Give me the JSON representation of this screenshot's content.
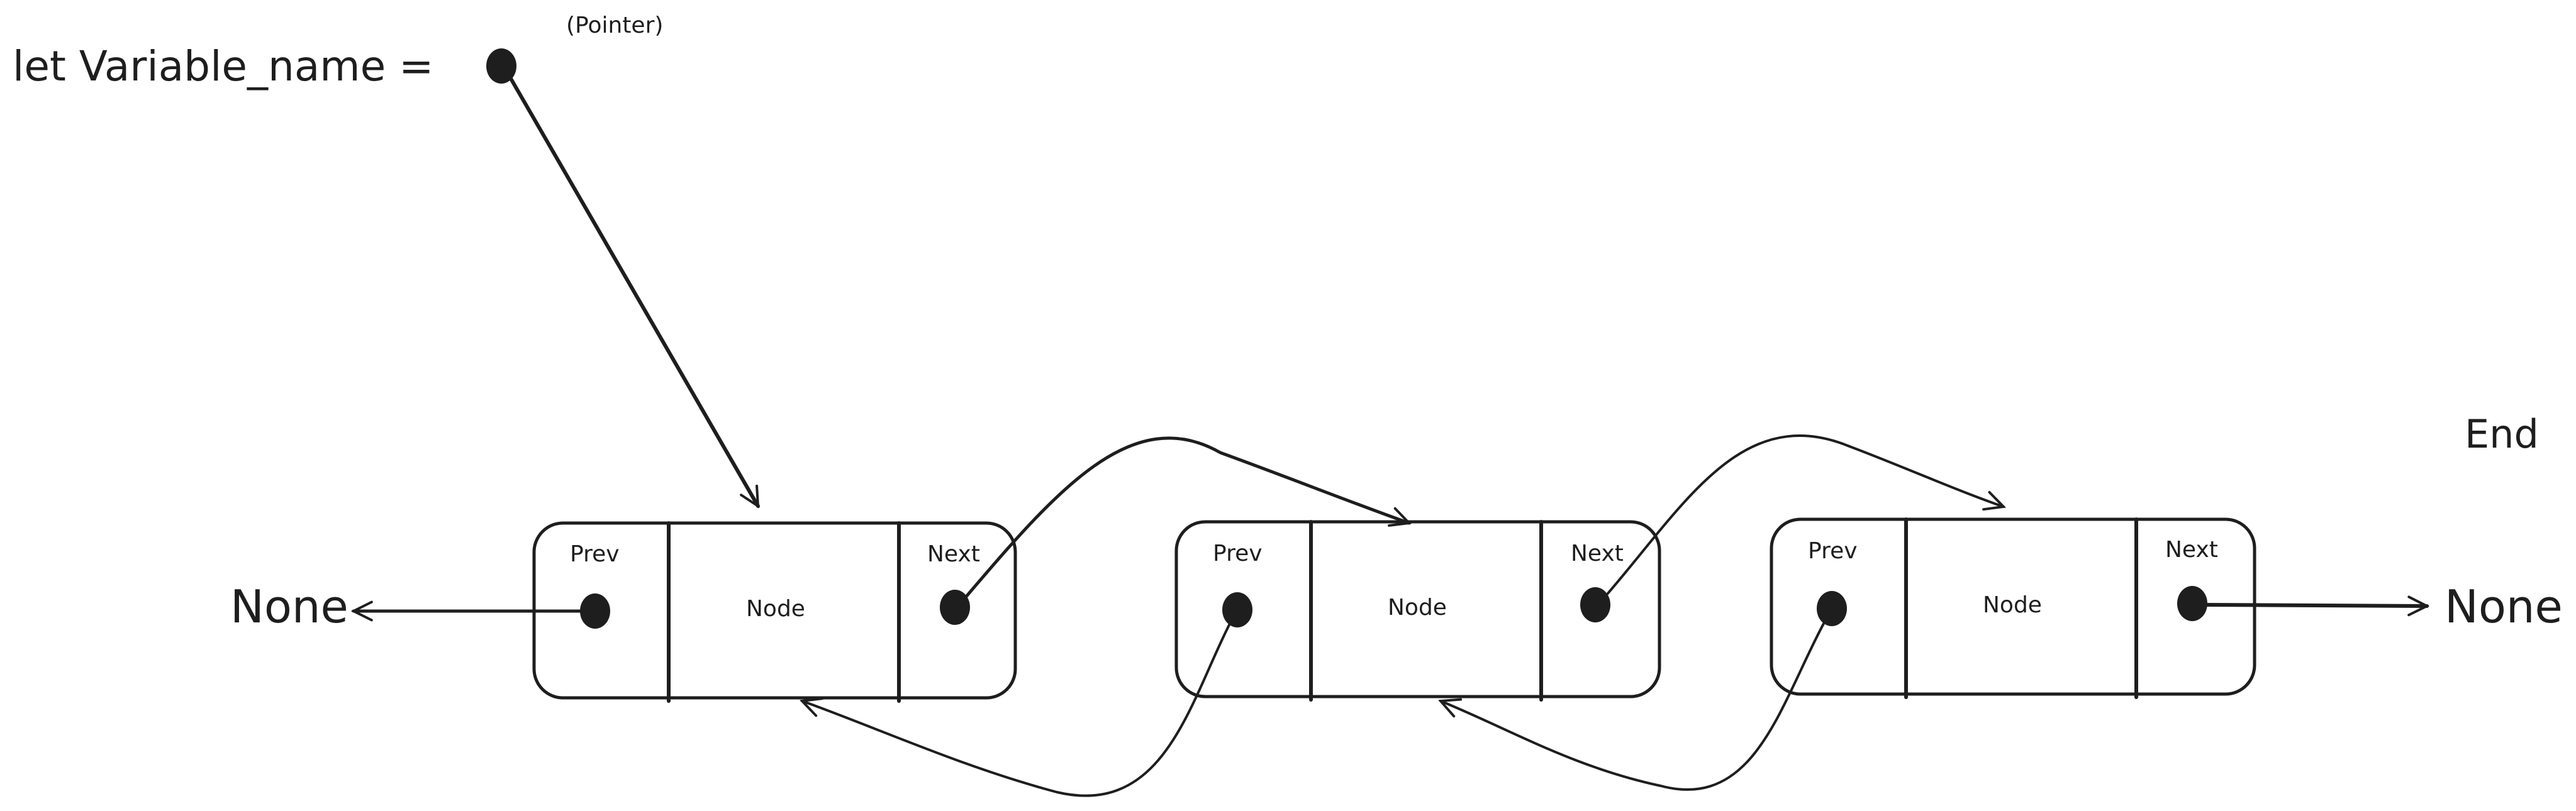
{
  "diagram": {
    "title_expression": "let Variable_name =",
    "pointer_label": "(Pointer)",
    "end_label": "End",
    "null_left": "None",
    "null_right": "None",
    "nodes": [
      {
        "prev_label": "Prev",
        "data_label": "Node",
        "next_label": "Next"
      },
      {
        "prev_label": "Prev",
        "data_label": "Node",
        "next_label": "Next"
      },
      {
        "prev_label": "Prev",
        "data_label": "Node",
        "next_label": "Next"
      }
    ],
    "colors": {
      "ink": "#1e1e1e",
      "background": "#ffffff"
    }
  }
}
